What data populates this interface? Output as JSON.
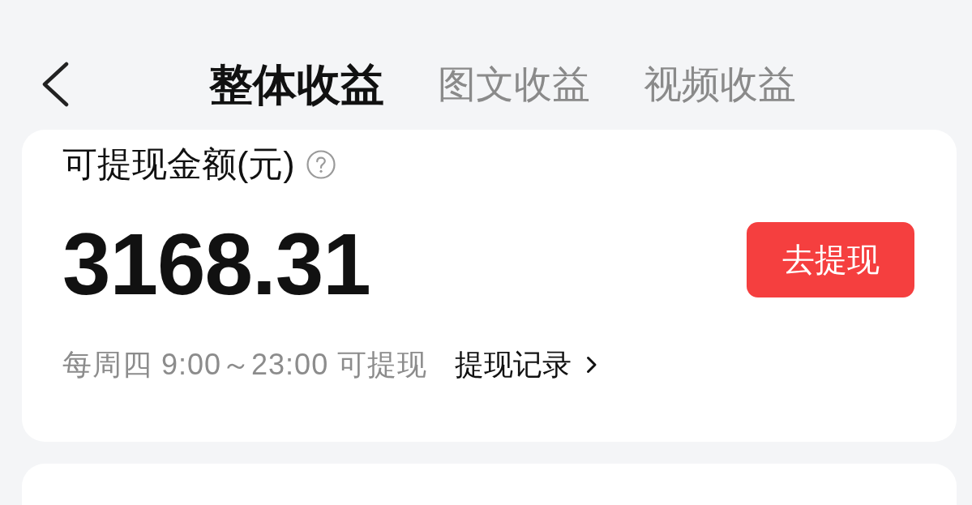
{
  "nav": {
    "tabs": [
      {
        "label": "整体收益",
        "selected": true
      },
      {
        "label": "图文收益",
        "selected": false
      },
      {
        "label": "视频收益",
        "selected": false
      }
    ]
  },
  "balance_card": {
    "label": "可提现金额(元)",
    "amount": "3168.31",
    "withdraw_button": "去提现",
    "schedule": "每周四 9:00～23:00 可提现",
    "records_link": "提现记录"
  }
}
